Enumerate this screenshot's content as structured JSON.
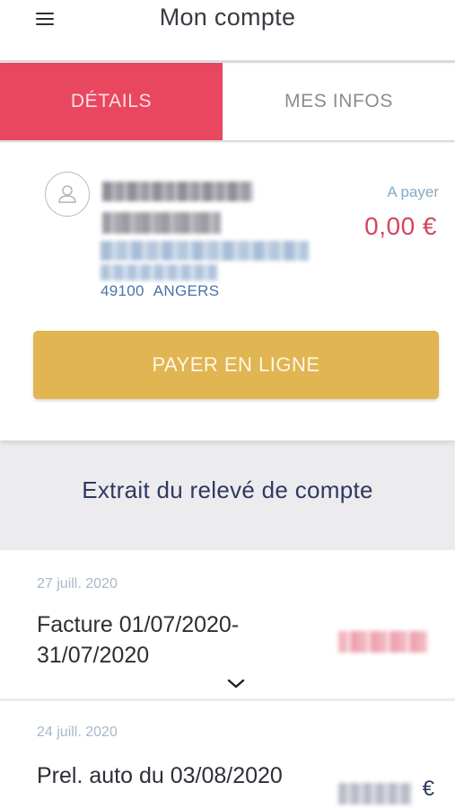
{
  "header": {
    "menu_icon": "hamburger-menu-icon",
    "title": "Mon compte"
  },
  "tabs": [
    {
      "label": "DÉTAILS",
      "active": true
    },
    {
      "label": "MES INFOS",
      "active": false
    }
  ],
  "account": {
    "avatar_icon": "user-icon",
    "city_postcode": "49100",
    "city_name": "ANGERS",
    "to_pay_label": "A payer",
    "to_pay_amount": "0,00 €",
    "pay_button_label": "PAYER EN LIGNE"
  },
  "statement": {
    "title": "Extrait du relevé de compte",
    "items": [
      {
        "date": "27 juill. 2020",
        "description": "Facture 01/07/2020-31/07/2020",
        "expand_icon": "chevron-down-icon"
      },
      {
        "date": "24 juill. 2020",
        "description": "Prel. auto du 03/08/2020",
        "currency": "€"
      }
    ]
  },
  "colors": {
    "tab_active": "#e8475f",
    "pay_button": "#e0b552",
    "amount_due": "#d2465e",
    "title_navy": "#2f3960"
  }
}
